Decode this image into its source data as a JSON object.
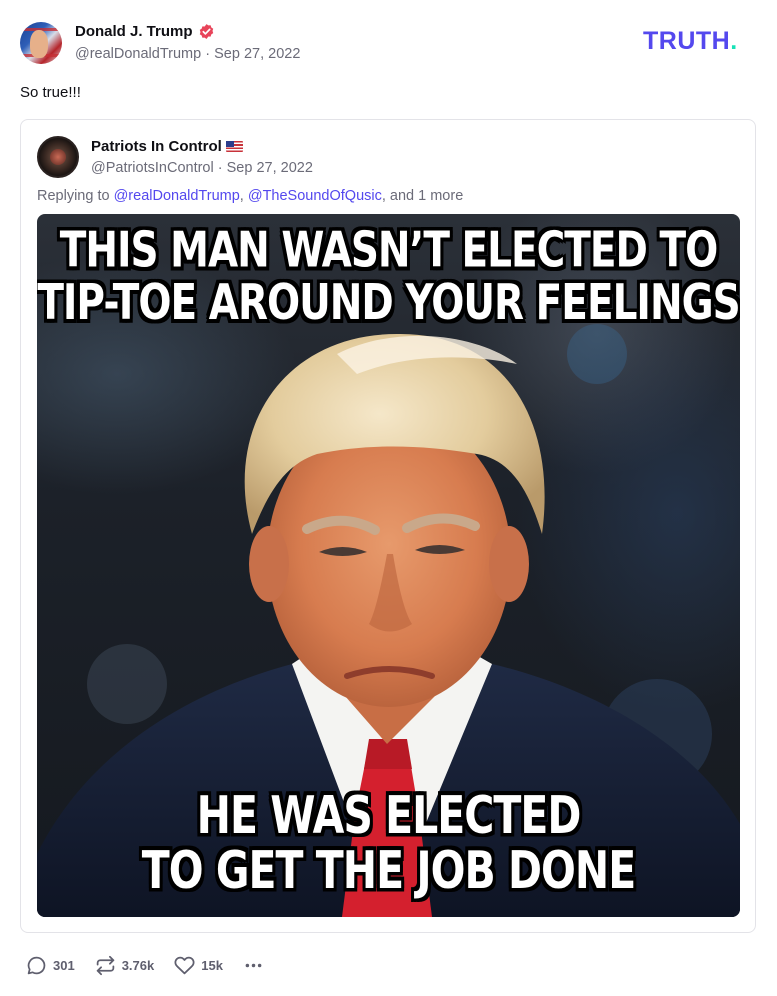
{
  "author": {
    "name": "Donald J. Trump",
    "handle": "@realDonaldTrump",
    "separator": "·",
    "date": "Sep 27, 2022",
    "avatar_icon": "user-avatar",
    "verified_icon": "verified-badge-icon"
  },
  "brand": {
    "logo_text": "TRUTH",
    "logo_dot": ".",
    "logo_color": "#5448ee",
    "dot_color": "#17e2b6"
  },
  "post": {
    "text": "So true!!!"
  },
  "quoted": {
    "name": "Patriots In Control",
    "flag_icon": "us-flag-icon",
    "handle": "@PatriotsInControl",
    "separator": "·",
    "date": "Sep 27, 2022",
    "replying_prefix": "Replying to ",
    "mentions": [
      "@realDonaldTrump",
      "@TheSoundOfQusic"
    ],
    "mention_separator": ", ",
    "replying_suffix": ", and 1 more",
    "meme": {
      "top_line_1": "THIS MAN WASN’T ELECTED TO",
      "top_line_2": "TIP-TOE AROUND YOUR FEELINGS",
      "bottom_line_1": "HE WAS ELECTED",
      "bottom_line_2": "TO GET THE JOB DONE"
    }
  },
  "actions": {
    "replies": "301",
    "retruths": "3.76k",
    "likes": "15k",
    "reply_icon": "comment-icon",
    "retruth_icon": "repost-icon",
    "like_icon": "heart-icon",
    "more_icon": "more-dots-icon",
    "icon_color": "#5f5f6e"
  }
}
